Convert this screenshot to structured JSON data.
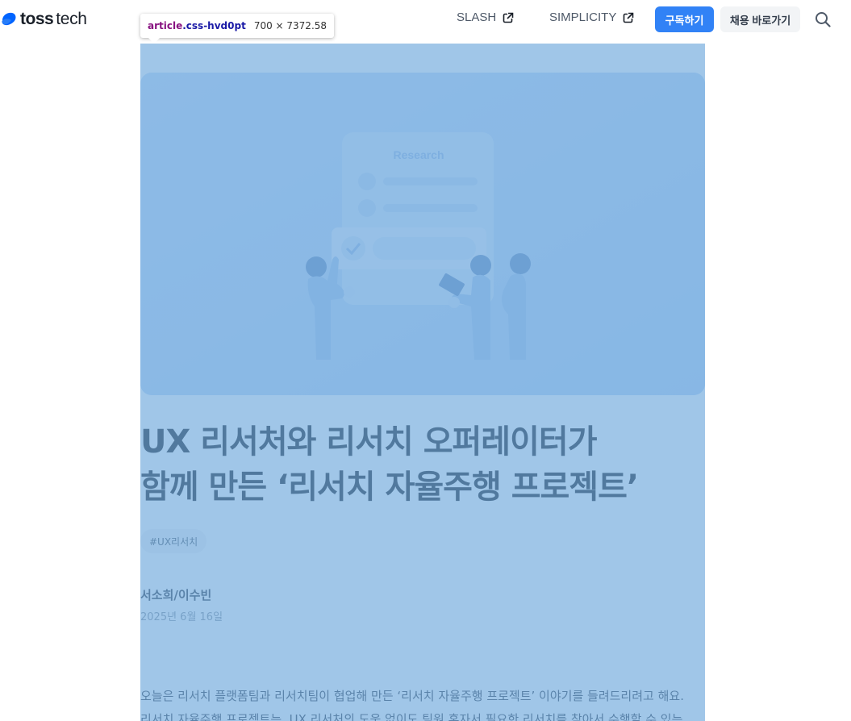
{
  "header": {
    "logo_bold": "toss",
    "logo_light": "tech",
    "nav": [
      {
        "label": "SLASH",
        "icon": "external-link-icon"
      },
      {
        "label": "SIMPLICITY",
        "icon": "external-link-icon"
      }
    ],
    "subscribe_label": "구독하기",
    "recruit_label": "채용 바로가기",
    "search_icon": "search-icon"
  },
  "devtools": {
    "tag": "article",
    "class": ".css-hvd0pt",
    "size": "700 × 7372.58",
    "highlight_color": "#6fa8dc"
  },
  "article": {
    "hero": {
      "card_heading": "Research",
      "icons": [
        "research-card-illustration",
        "check-icon",
        "person-figure"
      ]
    },
    "title_lines": [
      "UX 리서처와 리서치 오퍼레이터가",
      "함께 만든 ‘리서치 자율주행 프로젝트’"
    ],
    "tag": "#UX리서치",
    "author": "서소희/이수빈",
    "date": "2025년 6월 16일",
    "paragraph_1": "오늘은 리서치 플랫폼팀과 리서치팀이 협업해 만든 ‘리서치 자율주행 프로젝트’ 이야기를 들려드리려고 해요.",
    "paragraph_2": "리서치 자율주행 프로젝트는, UX 리서처의 도움 없이도 팀원 혼자서 필요한 리서치를 찾아서 수행할 수 있는"
  },
  "colors": {
    "brand_blue": "#3182f6",
    "text_primary": "#191f28",
    "text_secondary": "#4e5968"
  }
}
